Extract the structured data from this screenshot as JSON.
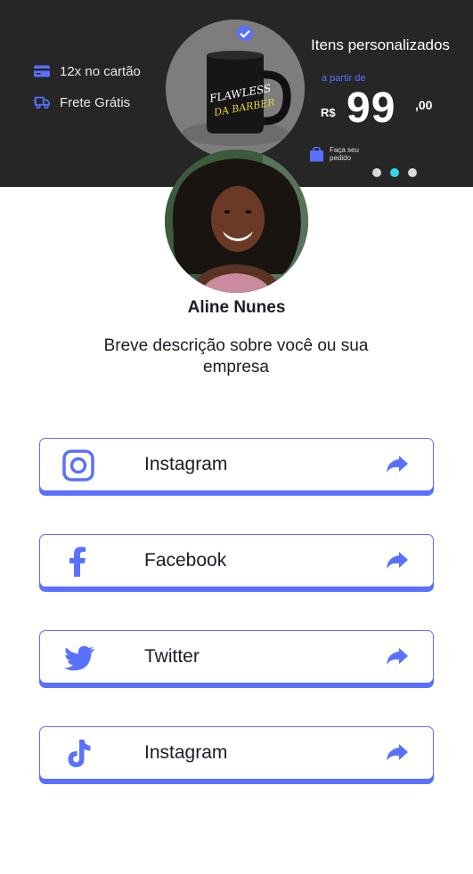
{
  "banner": {
    "features": [
      {
        "icon": "credit-card-icon",
        "label": "12x no cartão"
      },
      {
        "icon": "delivery-truck-icon",
        "label": "Frete Grátis"
      }
    ],
    "product": {
      "mug_text": "FLAWLESS DA BARBER"
    },
    "promo": {
      "title": "Itens personalizados",
      "subtitle": "a partir de",
      "currency": "R$",
      "price": "99",
      "cents": ",00",
      "order_label": "Faça seu pedido"
    },
    "carousel": {
      "count": 3,
      "active_index": 1
    }
  },
  "profile": {
    "name": "Aline Nunes",
    "description": "Breve descrição sobre você ou sua empresa"
  },
  "links": [
    {
      "icon": "instagram-icon",
      "label": "Instagram"
    },
    {
      "icon": "facebook-icon",
      "label": "Facebook"
    },
    {
      "icon": "twitter-icon",
      "label": "Twitter"
    },
    {
      "icon": "tiktok-icon",
      "label": "Instagram"
    }
  ],
  "colors": {
    "accent": "#5a70ff",
    "banner_bg": "#262626",
    "carousel_active": "#35d6e6",
    "text": "#1c1c28"
  }
}
